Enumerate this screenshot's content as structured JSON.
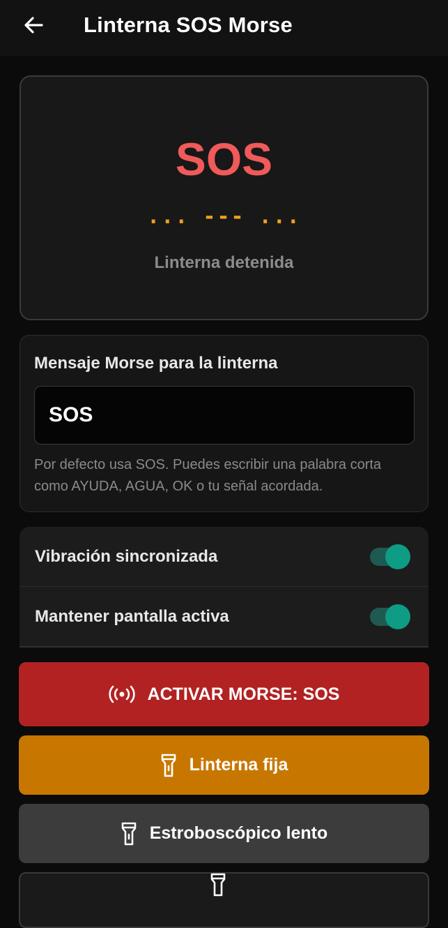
{
  "appbar": {
    "title": "Linterna SOS Morse",
    "back_icon": "arrow-left-icon"
  },
  "display": {
    "word": "SOS",
    "morse": "... --- ...",
    "status": "Linterna detenida",
    "word_color": "#f05a5a",
    "morse_color": "#f0a020"
  },
  "message": {
    "label": "Mensaje Morse para la linterna",
    "value": "SOS",
    "help": "Por defecto usa SOS. Puedes escribir una palabra corta como AYUDA, AGUA, OK o tu señal acordada."
  },
  "toggles": [
    {
      "label": "Vibración sincronizada",
      "on": true
    },
    {
      "label": "Mantener pantalla activa",
      "on": true
    }
  ],
  "buttons": {
    "morse": {
      "label": "ACTIVAR MORSE: SOS",
      "icon": "broadcast-icon",
      "color": "#b22222"
    },
    "fixed": {
      "label": "Linterna fija",
      "icon": "flashlight-icon",
      "color": "#c77700"
    },
    "strobe": {
      "label": "Estroboscópico lento",
      "icon": "flashlight-icon",
      "color": "#3c3c3c"
    },
    "next": {
      "icon": "flashlight-icon"
    }
  },
  "colors": {
    "accent_toggle": "#0e9c84",
    "background": "#0b0b0b"
  }
}
